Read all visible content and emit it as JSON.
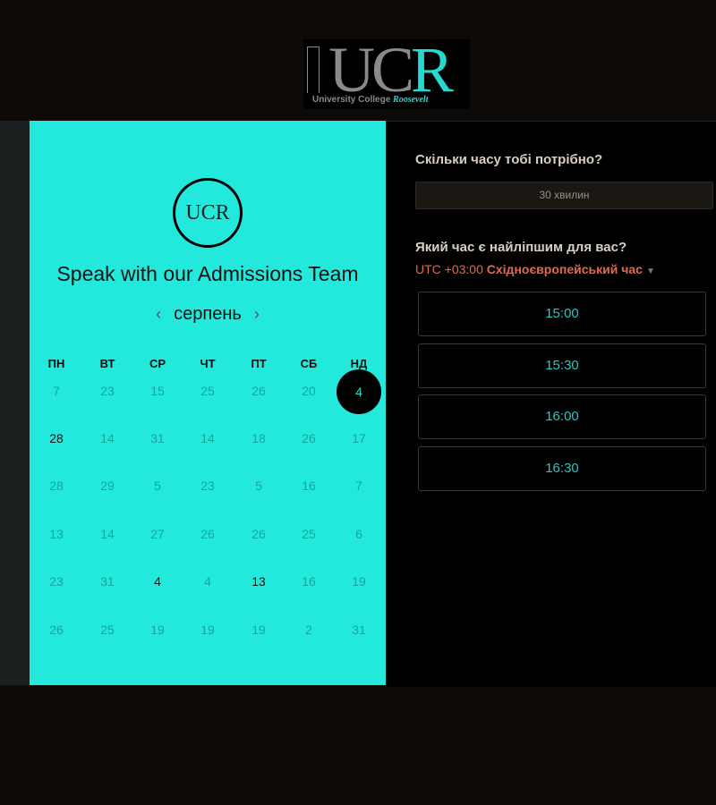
{
  "logo": {
    "letters": "UC",
    "accent": "R",
    "subtitle": "University College",
    "subtitle_accent": "Roosevelt",
    "badge": "UCR"
  },
  "calendar": {
    "title": "Speak with our Admissions Team",
    "month": "серпень",
    "prev": "‹",
    "next": "›",
    "weekdays": [
      "ПН",
      "ВТ",
      "СР",
      "ЧТ",
      "ПТ",
      "СБ",
      "НД"
    ],
    "weeks": [
      [
        "7",
        "23",
        "15",
        "25",
        "26",
        "20",
        "4"
      ],
      [
        "28",
        "14",
        "31",
        "14",
        "18",
        "26",
        "17"
      ],
      [
        "28",
        "29",
        "5",
        "23",
        "5",
        "16",
        "7"
      ],
      [
        "13",
        "14",
        "27",
        "26",
        "26",
        "25",
        "6"
      ],
      [
        "23",
        "31",
        "4",
        "4",
        "13",
        "16",
        "19"
      ],
      [
        "26",
        "25",
        "19",
        "19",
        "19",
        "2",
        "31"
      ]
    ],
    "selected": [
      0,
      6
    ],
    "available": [
      [
        1,
        0
      ],
      [
        4,
        2
      ],
      [
        4,
        4
      ]
    ]
  },
  "booking": {
    "duration_question": "Скільки часу тобі потрібно?",
    "duration": "30 хвилин",
    "time_question": "Який час є найліпшим для вас?",
    "tz_offset": "UTC +03:00",
    "tz_name": "Східноєвропейський час",
    "slots": [
      "15:00",
      "15:30",
      "16:00",
      "16:30"
    ]
  }
}
